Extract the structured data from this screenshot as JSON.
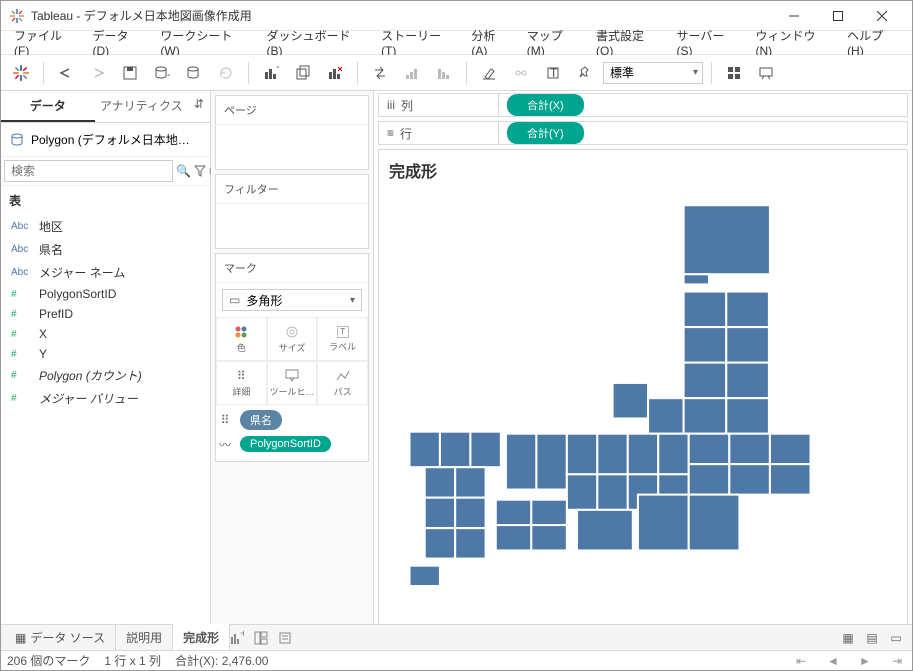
{
  "window": {
    "title": "Tableau - デフォルメ日本地図画像作成用"
  },
  "menu": {
    "file": "ファイル(F)",
    "data": "データ(D)",
    "worksheet": "ワークシート(W)",
    "dashboard": "ダッシュボード(B)",
    "story": "ストーリー(T)",
    "analysis": "分析(A)",
    "map": "マップ(M)",
    "format": "書式設定(O)",
    "server": "サーバー(S)",
    "window_m": "ウィンドウ(N)",
    "help": "ヘルプ(H)"
  },
  "toolbar": {
    "fit": "標準"
  },
  "sidepanel": {
    "tab_data": "データ",
    "tab_analytics": "アナリティクス",
    "datasource": "Polygon (デフォルメ日本地…",
    "search_placeholder": "検索",
    "tables_h": "表",
    "dims": [
      {
        "icon": "Abc",
        "name": "地区"
      },
      {
        "icon": "Abc",
        "name": "県名"
      },
      {
        "icon": "Abc",
        "name": "メジャー ネーム"
      }
    ],
    "meas": [
      {
        "icon": "#",
        "name": "PolygonSortID"
      },
      {
        "icon": "#",
        "name": "PrefID"
      },
      {
        "icon": "#",
        "name": "X"
      },
      {
        "icon": "#",
        "name": "Y"
      },
      {
        "icon": "#",
        "name": "Polygon (カウント)",
        "italic": true
      },
      {
        "icon": "#",
        "name": "メジャー バリュー",
        "italic": true
      }
    ]
  },
  "cards": {
    "pages": "ページ",
    "filters": "フィルター",
    "marks": "マーク",
    "marktype": "多角形",
    "mark_cells": [
      "色",
      "サイズ",
      "ラベル",
      "詳細",
      "ツールヒ…",
      "パス"
    ],
    "mark_pills": [
      {
        "cls": "blue",
        "icon": "⠿",
        "text": "県名"
      },
      {
        "cls": "teal",
        "icon": "〰",
        "text": "PolygonSortID"
      }
    ]
  },
  "shelves": {
    "cols_label": "列",
    "rows_label": "行",
    "col_pill": "合計(X)",
    "row_pill": "合計(Y)"
  },
  "viz": {
    "title": "完成形"
  },
  "chart_data": {
    "type": "polygon-map",
    "title": "完成形",
    "x_field": "合計(X)",
    "y_field": "合計(Y)",
    "detail": "県名",
    "path": "PolygonSortID",
    "fill": "#4e79a7",
    "note": "Deformed (grid) map of Japan; each polygon is a prefecture rendered as a tile."
  },
  "bottomtabs": {
    "datasource": "データ ソース",
    "sheet1": "説明用",
    "sheet2": "完成形"
  },
  "status": {
    "marks": "206 個のマーク",
    "dims": "1 行 x 1 列",
    "sumx": "合計(X): 2,476.00"
  }
}
